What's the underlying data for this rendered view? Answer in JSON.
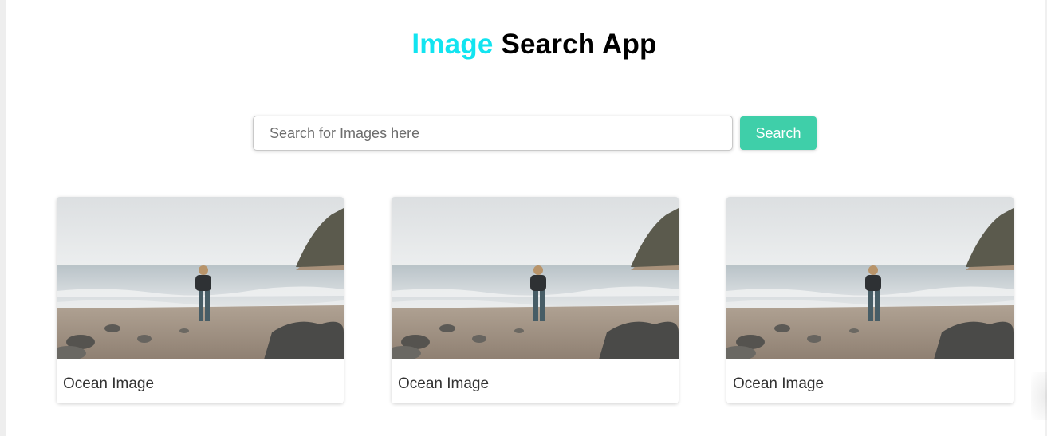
{
  "header": {
    "title_accent": "Image",
    "title_rest": " Search App",
    "accent_color": "#12e4f0"
  },
  "search": {
    "placeholder": "Search for Images here",
    "value": "",
    "button_label": "Search",
    "button_color": "#3fcfa9"
  },
  "results": [
    {
      "caption": "Ocean Image",
      "image": "woman standing on rocky beach facing the ocean"
    },
    {
      "caption": "Ocean Image",
      "image": "woman standing on rocky beach facing the ocean"
    },
    {
      "caption": "Ocean Image",
      "image": "woman standing on rocky beach facing the ocean"
    }
  ]
}
